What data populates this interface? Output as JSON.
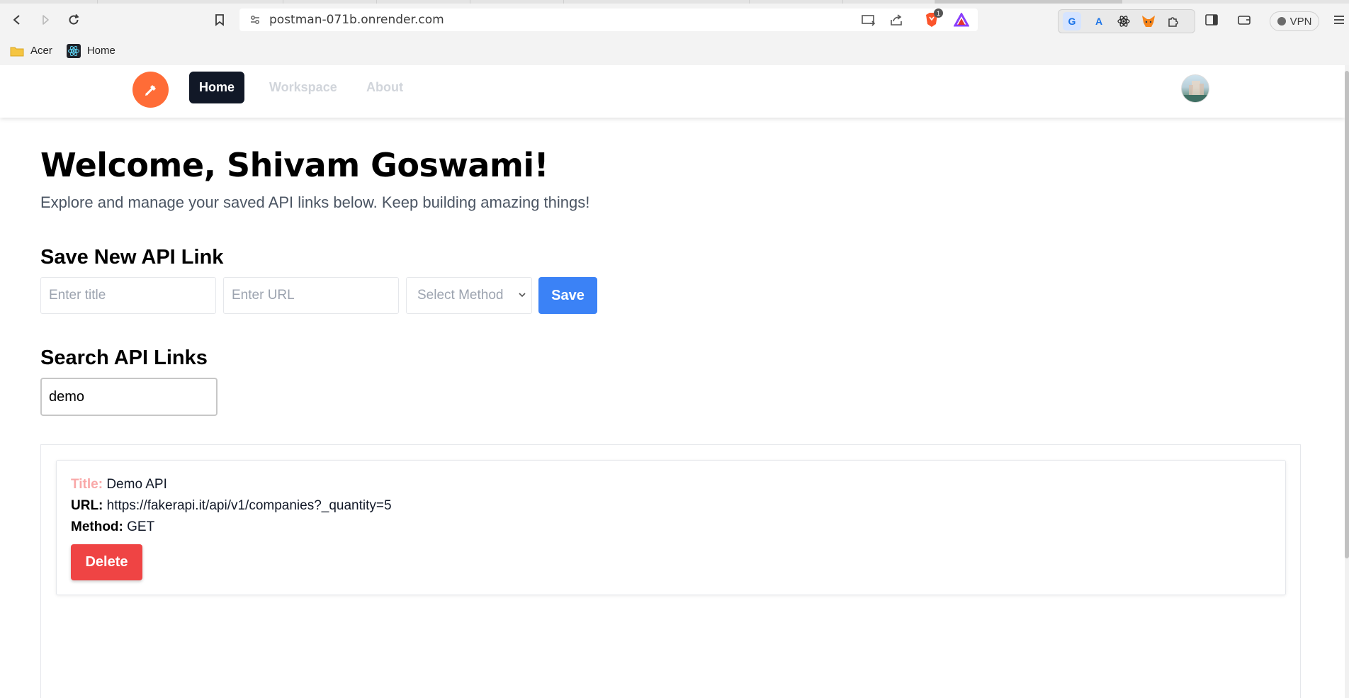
{
  "browser": {
    "url": "postman-071b.onrender.com",
    "icons": [
      "back-icon",
      "forward-icon",
      "reload-icon",
      "bookmark-icon",
      "site-settings-icon",
      "cast-icon",
      "share-icon",
      "brave-shield-icon",
      "brave-rewards-icon",
      "google-translate-icon",
      "translate-icon",
      "react-devtools-icon",
      "metamask-icon",
      "extensions-icon",
      "sidebar-icon",
      "wallet-icon",
      "menu-icon"
    ],
    "shield_badge": "1",
    "vpn_label": "VPN",
    "bookmarks": [
      {
        "label": "Acer",
        "icon": "folder-icon"
      },
      {
        "label": "Home",
        "icon": "react-icon"
      }
    ]
  },
  "navbar": {
    "logo_icon": "postman-logo-icon",
    "links": [
      {
        "label": "Home",
        "active": true
      },
      {
        "label": "Workspace",
        "active": false
      },
      {
        "label": "About",
        "active": false
      }
    ],
    "avatar": "user-avatar"
  },
  "main": {
    "welcome": "Welcome, Shivam Goswami!",
    "subtitle": "Explore and manage your saved API links below. Keep building amazing things!",
    "save_section": {
      "heading": "Save New API Link",
      "title_placeholder": "Enter title",
      "url_placeholder": "Enter URL",
      "method_select": "Select Method",
      "save_label": "Save"
    },
    "search_section": {
      "heading": "Search API Links",
      "value": "demo"
    },
    "results": [
      {
        "title_label": "Title:",
        "title": "Demo API",
        "url_label": "URL:",
        "url": "https://fakerapi.it/api/v1/companies?_quantity=5",
        "method_label": "Method:",
        "method": "GET",
        "delete_label": "Delete"
      }
    ]
  },
  "colors": {
    "accent": "#3b82f6",
    "danger": "#ef4444",
    "nav_active_bg": "#111827",
    "logo": "#ff6c37"
  }
}
